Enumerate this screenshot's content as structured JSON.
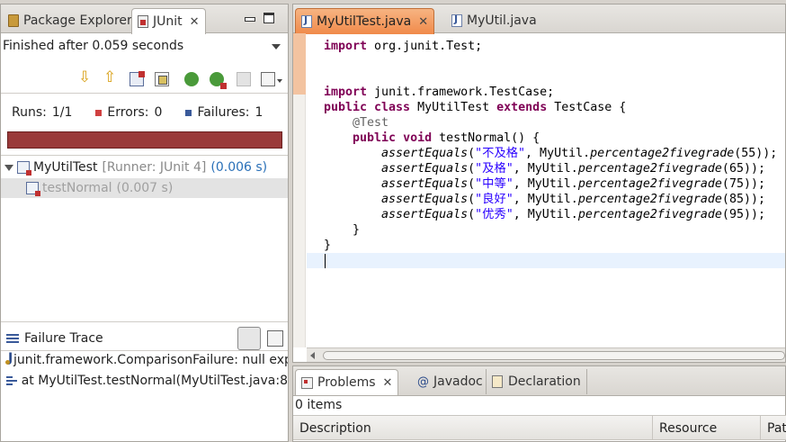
{
  "left_panel": {
    "tabs": [
      {
        "label": "Package Explorer",
        "icon": "package-explorer-icon"
      },
      {
        "label": "JUnit",
        "icon": "junit-icon",
        "active": true
      }
    ],
    "status": "Finished after 0.059 seconds",
    "counters": {
      "runs_label": "Runs:",
      "runs_value": "1/1",
      "errors_label": "Errors:",
      "errors_value": "0",
      "failures_label": "Failures:",
      "failures_value": "1"
    },
    "progress_color": "#9a3a3a",
    "tree": {
      "root_name": "MyUtilTest",
      "root_runner": "[Runner: JUnit 4]",
      "root_time": "(0.006 s)",
      "child_name": "testNormal",
      "child_time": "(0.007 s)"
    },
    "failure_trace": {
      "title": "Failure Trace",
      "lines": [
        "junit.framework.ComparisonFailure: null exp",
        "at MyUtilTest.testNormal(MyUtilTest.java:8"
      ]
    }
  },
  "editor": {
    "tabs": [
      {
        "label": "MyUtilTest.java",
        "active": true
      },
      {
        "label": "MyUtil.java"
      }
    ],
    "code": {
      "l1_kw": "import",
      "l1_rest": " org.junit.Test;",
      "l4_kw": "import",
      "l4_rest": " junit.framework.TestCase;",
      "l5_kw1": "public class",
      "l5_mid": " MyUtilTest ",
      "l5_kw2": "extends",
      "l5_rest": " TestCase {",
      "l6_ann": "    @Test",
      "l7_indent": "    ",
      "l7_kw": "public void",
      "l7_rest": " testNormal() {",
      "asserts": [
        {
          "str": "\"不及格\"",
          "arg": "55"
        },
        {
          "str": "\"及格\"",
          "arg": "65"
        },
        {
          "str": "\"中等\"",
          "arg": "75"
        },
        {
          "str": "\"良好\"",
          "arg": "85"
        },
        {
          "str": "\"优秀\"",
          "arg": "95"
        }
      ],
      "assert_fn": "assertEquals",
      "assert_mid": ", MyUtil.",
      "method_fn": "percentage2fivegrade",
      "l13": "    }",
      "l14": "}"
    }
  },
  "bottom_panel": {
    "tabs": [
      {
        "label": "Problems",
        "active": true
      },
      {
        "label": "Javadoc"
      },
      {
        "label": "Declaration"
      }
    ],
    "items_count": "0 items",
    "columns": [
      "Description",
      "Resource",
      "Pat"
    ]
  }
}
